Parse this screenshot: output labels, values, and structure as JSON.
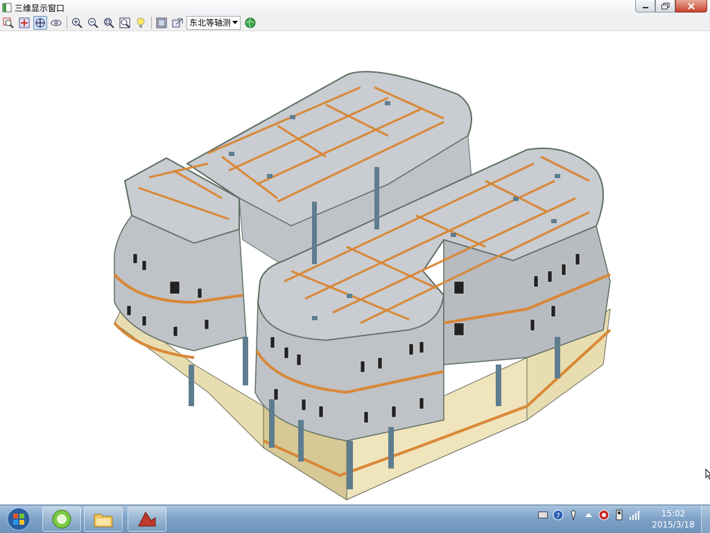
{
  "window": {
    "title": "三维显示窗口",
    "buttons": {
      "minimize": "minimize",
      "maximize": "maximize",
      "close": "close"
    }
  },
  "toolbar": {
    "tools": [
      "zoom-region-icon",
      "zoom-move-icon",
      "pan-rotate-icon",
      "orbit-icon",
      "zoom-in-icon",
      "zoom-out-icon",
      "zoom-window-icon",
      "zoom-extents-icon",
      "light-bulb-icon",
      "render-settings-icon",
      "export-image-icon"
    ],
    "view_select": {
      "value": "东北等轴测"
    },
    "globe": "globe-icon"
  },
  "taskbar": {
    "apps": [
      "start-orb-icon",
      "app-circle-icon",
      "folder-icon",
      "structure-app-icon"
    ],
    "tray": [
      "keyboard-icon",
      "help-icon",
      "pen-icon",
      "up-arrow-icon",
      "record-icon",
      "usb-icon",
      "signal-icon"
    ],
    "time": "15:02",
    "date": "2015/3/18"
  },
  "colors": {
    "roof": "#c9ccd0",
    "beam": "#d88838",
    "column": "#5e7d8f",
    "base": "#e8ddb0",
    "facade": "#bfc2c6",
    "outline": "#5d6e63"
  }
}
